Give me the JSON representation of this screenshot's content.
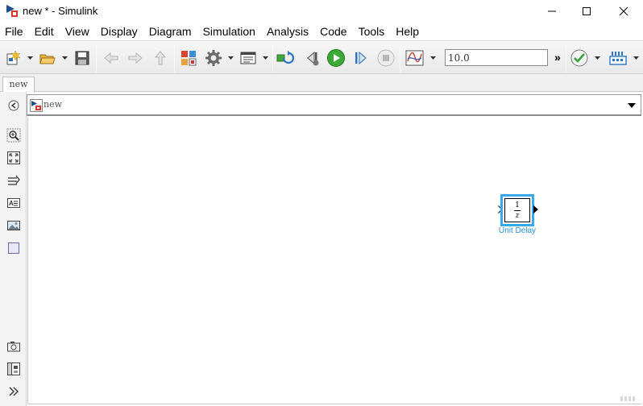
{
  "window": {
    "title": "new * - Simulink",
    "controls": {
      "minimize": "minimize-icon",
      "maximize": "maximize-icon",
      "close": "close-icon"
    }
  },
  "menu": {
    "items": [
      "File",
      "Edit",
      "View",
      "Display",
      "Diagram",
      "Simulation",
      "Analysis",
      "Code",
      "Tools",
      "Help"
    ]
  },
  "toolbar": {
    "stop_time": "10.0",
    "overflow": "»",
    "icons": [
      "new-model-icon",
      "open-icon",
      "save-icon",
      "back-icon",
      "forward-icon",
      "up-icon",
      "library-browser-icon",
      "model-config-icon",
      "model-explorer-icon",
      "update-diagram-icon",
      "step-back-icon",
      "run-icon",
      "step-forward-icon",
      "stop-icon",
      "scope-icon",
      "model-advisor-icon",
      "build-icon"
    ]
  },
  "tabs": [
    {
      "label": "new"
    }
  ],
  "address": {
    "path": "new"
  },
  "palette": {
    "icons": [
      "hide-browser-icon",
      "zoom-icon",
      "fit-view-icon",
      "route-lines-icon",
      "annotation-icon",
      "image-icon",
      "area-icon",
      "screenshot-icon",
      "model-browser-icon",
      "expand-icon"
    ]
  },
  "block": {
    "numerator": "1",
    "denominator": "z",
    "label": "Unit Delay",
    "selected_color": "#38a9ee"
  }
}
